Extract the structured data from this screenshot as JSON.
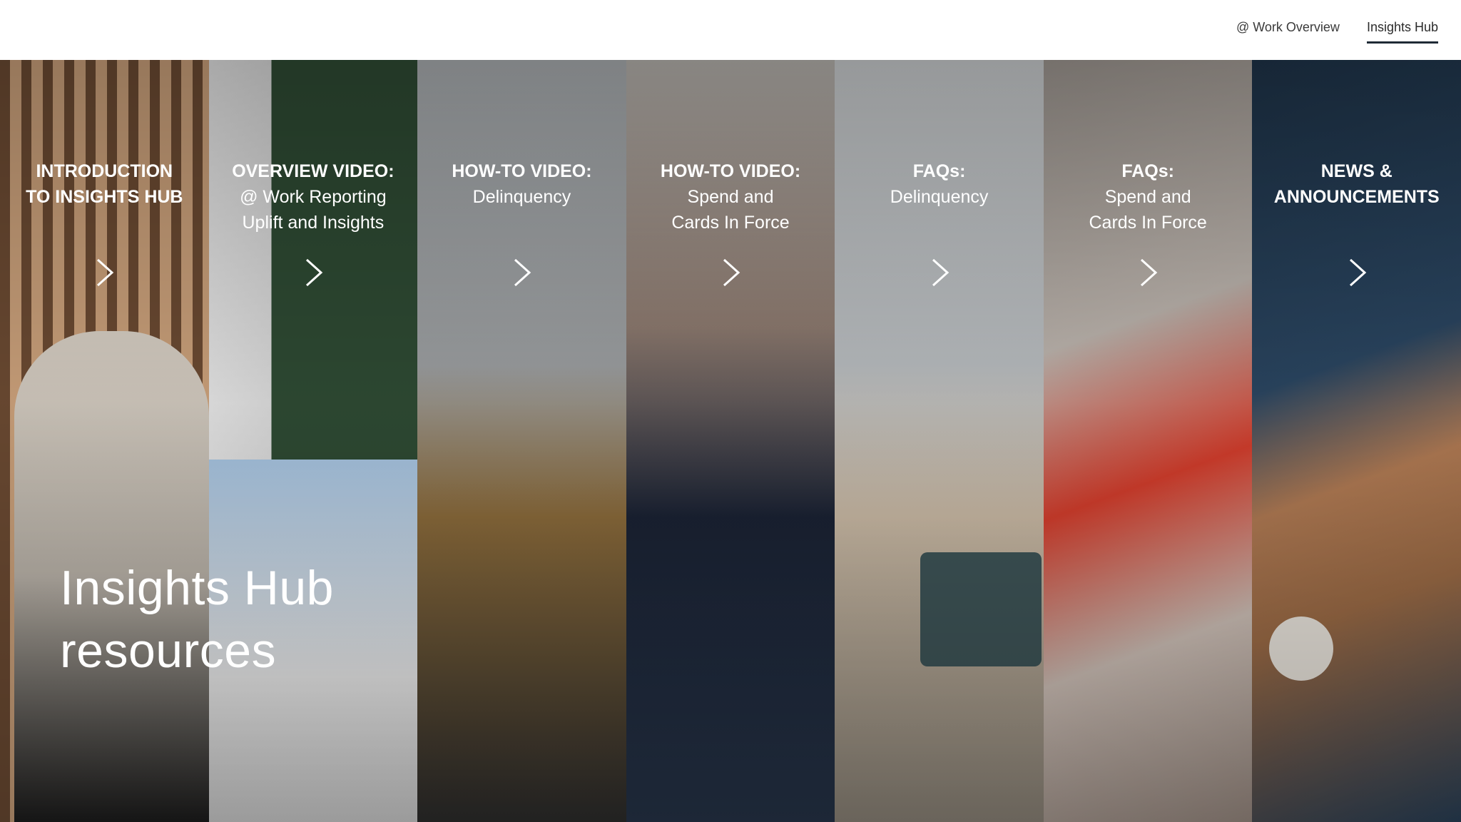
{
  "nav": {
    "links": [
      {
        "label": "@ Work Overview",
        "active": false
      },
      {
        "label": "Insights Hub",
        "active": true
      }
    ]
  },
  "panels": [
    {
      "kicker": "INTRODUCTION TO INSIGHTS HUB",
      "sub": "",
      "icon": "chevron-right-icon"
    },
    {
      "kicker": "OVERVIEW VIDEO:",
      "sub": "@ Work Reporting Uplift and Insights",
      "icon": "chevron-right-icon"
    },
    {
      "kicker": "HOW-TO VIDEO:",
      "sub": "Delinquency",
      "icon": "chevron-right-icon"
    },
    {
      "kicker": "HOW-TO VIDEO:",
      "sub": "Spend and Cards In Force",
      "icon": "chevron-right-icon"
    },
    {
      "kicker": "FAQs:",
      "sub": "Delinquency",
      "icon": "chevron-right-icon"
    },
    {
      "kicker": "FAQs:",
      "sub": "Spend and Cards In Force",
      "icon": "chevron-right-icon"
    },
    {
      "kicker": "NEWS & ANNOUNCEMENTS",
      "sub": "",
      "icon": "chevron-right-icon"
    }
  ],
  "hero": {
    "title_line1": "Insights Hub",
    "title_line2": "resources"
  },
  "colors": {
    "nav_underline": "#1f2a36",
    "panel_text": "#ffffff"
  }
}
